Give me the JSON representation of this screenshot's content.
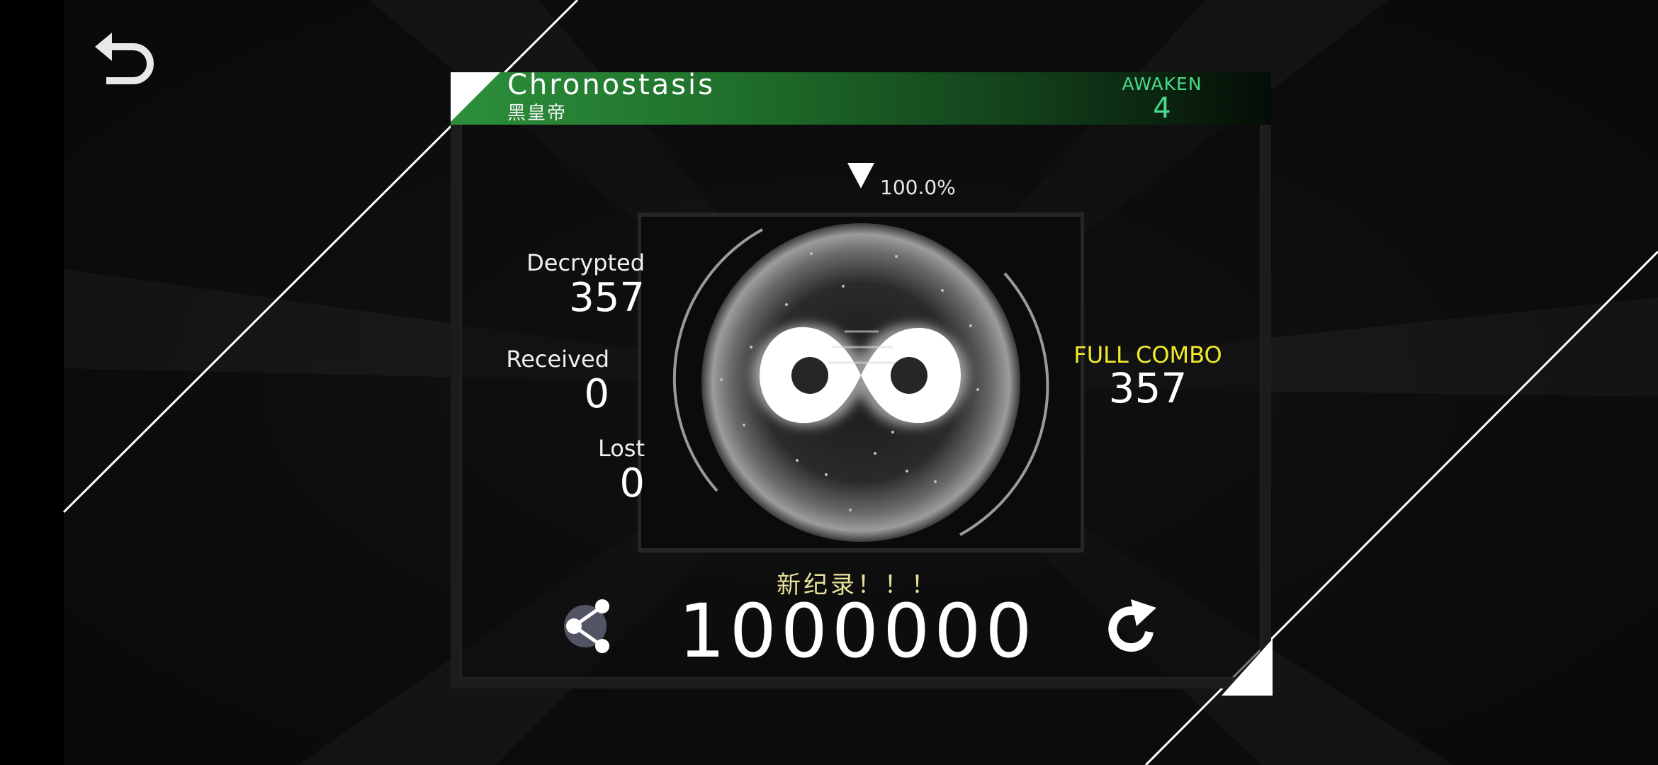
{
  "song": {
    "title": "Chronostasis",
    "artist": "黑皇帝",
    "difficulty_label": "AWAKEN",
    "difficulty_level": "4"
  },
  "result": {
    "completion_percent": "100.0%",
    "decrypted_label": "Decrypted",
    "decrypted_value": "357",
    "received_label": "Received",
    "received_value": "0",
    "lost_label": "Lost",
    "lost_value": "0",
    "full_combo_label": "FULL COMBO",
    "full_combo_value": "357",
    "new_record_label": "新纪录！！！",
    "score": "1000000"
  },
  "icons": {
    "back": "back-arrow-icon",
    "share": "share-icon",
    "retry": "retry-icon",
    "emblem": "infinity-icon"
  },
  "colors": {
    "title_bar": "#2c8f3b",
    "difficulty": "#4ad98a",
    "full_combo": "#f2ea2a",
    "new_record": "#e6e199"
  }
}
